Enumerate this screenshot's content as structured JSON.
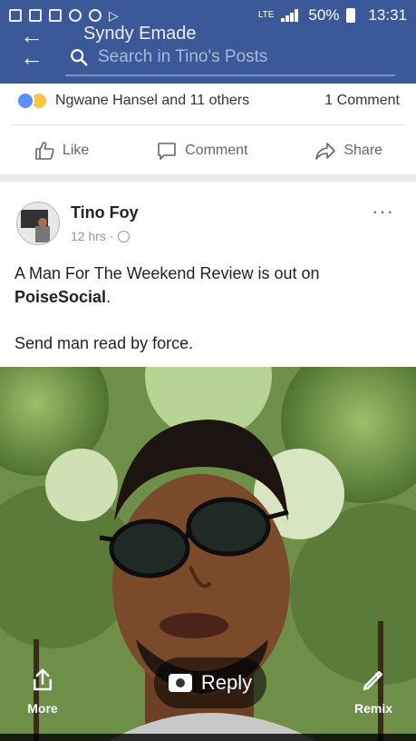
{
  "status_bar": {
    "network": "LTE",
    "battery": "50%",
    "time": "13:31"
  },
  "header": {
    "title": "Syndy Emade",
    "search_placeholder": "Search in Tino's Posts"
  },
  "reactions": {
    "names": "Ngwane Hansel and 11 others",
    "comments": "1 Comment"
  },
  "actions": {
    "like": "Like",
    "comment": "Comment",
    "share": "Share"
  },
  "post": {
    "author": "Tino Foy",
    "time": "12 hrs",
    "more": "···",
    "text_prefix": "A Man For The Weekend Review is out on",
    "text_bold": "PoiseSocial",
    "text_suffix": ".",
    "text_line2": "Send man read by force."
  },
  "overlay": {
    "reply": "Reply",
    "more": "More",
    "remix": "Remix"
  },
  "colors": {
    "facebook_blue": "#3b5998",
    "text": "#1d2129",
    "muted": "#90949c"
  }
}
